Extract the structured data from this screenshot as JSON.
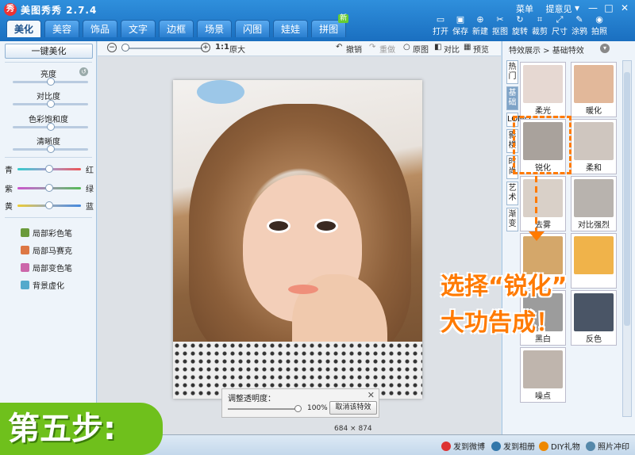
{
  "app": {
    "title": "美图秀秀 2.7.4",
    "logo": "秀"
  },
  "top_links": {
    "menu": "菜单",
    "feedback": "提意见"
  },
  "window_controls": [
    "▾",
    "—",
    "□",
    "✕"
  ],
  "tabs": [
    {
      "label": "美化",
      "active": true
    },
    {
      "label": "美容"
    },
    {
      "label": "饰品"
    },
    {
      "label": "文字"
    },
    {
      "label": "边框"
    },
    {
      "label": "场景"
    },
    {
      "label": "闪图"
    },
    {
      "label": "娃娃"
    },
    {
      "label": "拼图",
      "badge": "新"
    }
  ],
  "toolbar": [
    {
      "label": "打开",
      "icon": "open-icon"
    },
    {
      "label": "保存",
      "icon": "save-icon"
    },
    {
      "label": "新建",
      "icon": "new-icon"
    },
    {
      "label": "抠图",
      "icon": "cutout-icon"
    },
    {
      "label": "旋转",
      "icon": "rotate-icon"
    },
    {
      "label": "裁剪",
      "icon": "crop-icon"
    },
    {
      "label": "尺寸",
      "icon": "resize-icon"
    },
    {
      "label": "涂鸦",
      "icon": "doodle-icon"
    },
    {
      "label": "拍照",
      "icon": "camera-icon"
    }
  ],
  "left": {
    "one_click": "一键美化",
    "adjust": [
      {
        "label": "亮度",
        "level": 0.5
      },
      {
        "label": "对比度",
        "level": 0.5
      },
      {
        "label": "色彩饱和度",
        "level": 0.5
      },
      {
        "label": "清晰度",
        "level": 0.5
      }
    ],
    "color_rows": [
      {
        "left": "青",
        "right": "红",
        "level": 0.5
      },
      {
        "left": "紫",
        "right": "绿",
        "level": 0.5
      },
      {
        "left": "黄",
        "right": "蓝",
        "level": 0.5
      }
    ],
    "brushes": [
      {
        "label": "局部彩色笔",
        "color": "#6a9a3a"
      },
      {
        "label": "局部马赛克",
        "color": "#d74"
      },
      {
        "label": "局部变色笔",
        "color": "#c6a"
      },
      {
        "label": "背景虚化",
        "color": "#5ac"
      }
    ]
  },
  "center": {
    "zoom_ratio": "1:1",
    "zoom_orig": "原大",
    "undo": "撤销",
    "redo": "重做",
    "original": "原图",
    "compare": "对比",
    "preview": "预览",
    "opacity_title": "调整透明度：",
    "opacity_value": "100%",
    "cancel_effect": "取消该特效",
    "image_size": "684 × 874"
  },
  "right": {
    "breadcrumb": "特效展示 > 基础特效",
    "vtabs": [
      "热门",
      "基础",
      "LOMO",
      "影楼",
      "时尚",
      "艺术",
      "渐变"
    ],
    "effects": [
      {
        "label": "柔光",
        "tone": "#e6d8d2"
      },
      {
        "label": "暖化",
        "tone": "#e2b89a"
      },
      {
        "label": "锐化",
        "tone": "#a9a29c"
      },
      {
        "label": "柔和",
        "tone": "#cfc6bf"
      },
      {
        "label": "去雾",
        "tone": "#d9d0c8"
      },
      {
        "label": "对比强烈",
        "tone": "#b8b3ae"
      },
      {
        "label": "",
        "tone": "#d4a76a"
      },
      {
        "label": "",
        "tone": "#f0b34a"
      },
      {
        "label": "黑白",
        "tone": "#9c9c9c"
      },
      {
        "label": "反色",
        "tone": "#4a5566"
      },
      {
        "label": "噪点",
        "tone": "#bfb5ad"
      }
    ]
  },
  "annotations": {
    "callout_line1": "选择“锐化”",
    "callout_line2": "大功告成！",
    "step": "第五步:"
  },
  "bottom": [
    {
      "label": "发到微博",
      "color": "#d33"
    },
    {
      "label": "发到相册",
      "color": "#37a"
    },
    {
      "label": "DIY礼物",
      "color": "#e80"
    },
    {
      "label": "照片冲印",
      "color": "#58a"
    }
  ]
}
